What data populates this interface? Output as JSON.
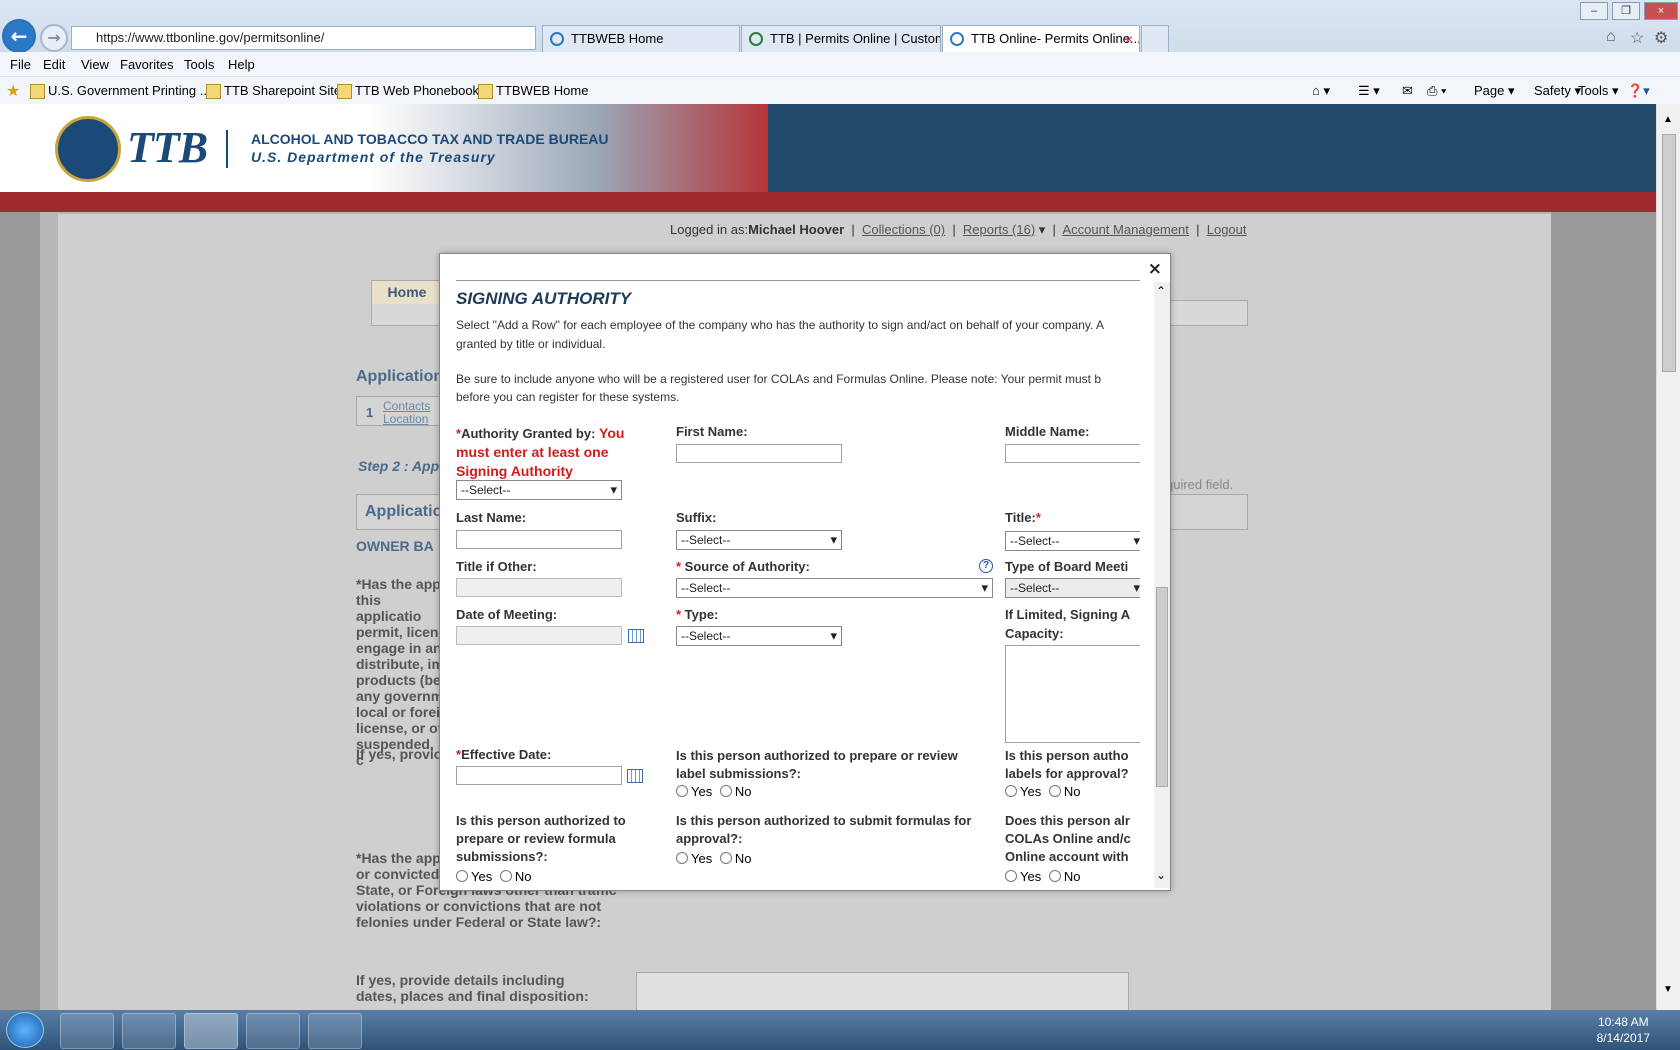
{
  "browser": {
    "url": "https://www.ttbonline.gov/permitsonline/",
    "tabs": [
      "TTBWEB Home",
      "TTB | Permits Online | Custom...",
      "TTB Online- Permits Online..."
    ],
    "menu": [
      "File",
      "Edit",
      "View",
      "Favorites",
      "Tools",
      "Help"
    ],
    "favorites": [
      "U.S. Government Printing ...",
      "TTB Sharepoint Site",
      "TTB Web Phonebook",
      "TTBWEB Home"
    ],
    "commands": [
      "Page ▾",
      "Safety ▾",
      "Tools ▾"
    ]
  },
  "header": {
    "logo": "TTB",
    "bureau": "ALCOHOL AND TOBACCO TAX AND TRADE BUREAU",
    "dept": "U.S. Department of the Treasury"
  },
  "userbar": {
    "logged_in_label": "Logged in as:",
    "user": "Michael Hoover",
    "collections": "Collections (0)",
    "reports": "Reports (16)",
    "account": "Account Management",
    "logout": "Logout"
  },
  "background": {
    "home_tab": "Home",
    "application": "Application",
    "step_num": "1",
    "step_contacts": "Contacts",
    "step_location": "Location",
    "step2": "Step 2 : App",
    "required_note": "quired field.",
    "application_bar": "Applicatio",
    "owner": "OWNER BA",
    "q1": "*Has the app this applicatio permit, licen engage in an distribute, im products (be any governm local or forei license, or ot suspended, c",
    "if_yes1": "If yes, provic",
    "q2": "*Has the app this applicatio charged with, or convicted of any crime under Federal, State, or Foreign laws other than traffic violations or convictions that are not felonies under Federal or State law?:",
    "if_yes2": "If yes, provide details including dates, places and final disposition:"
  },
  "modal": {
    "title": "SIGNING AUTHORITY",
    "intro1": "Select \"Add a Row\" for each employee of the company who has the authority to sign and/act on behalf of your company. A",
    "intro1b": "granted by title or individual.",
    "intro2": "Be sure to include anyone who will be a registered user for COLAs and Formulas Online. Please note: Your permit must b",
    "intro2b": "before you can register for these systems.",
    "authority_label": "Authority Granted by:",
    "authority_error": "You must enter at least one Signing Authority",
    "first_name": "First Name:",
    "middle_name": "Middle Name:",
    "last_name": "Last Name:",
    "suffix": "Suffix:",
    "title_label": "Title:",
    "title_other": "Title if Other:",
    "source": "Source of Authority:",
    "board_meeting": "Type of Board Meeti",
    "date_meeting": "Date of Meeting:",
    "type": "Type:",
    "limited": "If Limited, Signing A",
    "capacity": "Capacity:",
    "effective": "Effective Date:",
    "q_label": "Is this person authorized to prepare or review label submissions?:",
    "q_labels_approval": "Is this person autho labels for approval?",
    "q_formula": "Is this person authorized to prepare or review formula submissions?:",
    "q_submit_formula": "Is this person authorized to submit formulas for approval?:",
    "q_colas": "Does this person alr COLAs Online and/c Online account with",
    "select": "--Select--",
    "yes": "Yes",
    "no": "No",
    "close": "×",
    "help": "?"
  },
  "taskbar": {
    "time": "10:48 AM",
    "date": "8/14/2017"
  }
}
